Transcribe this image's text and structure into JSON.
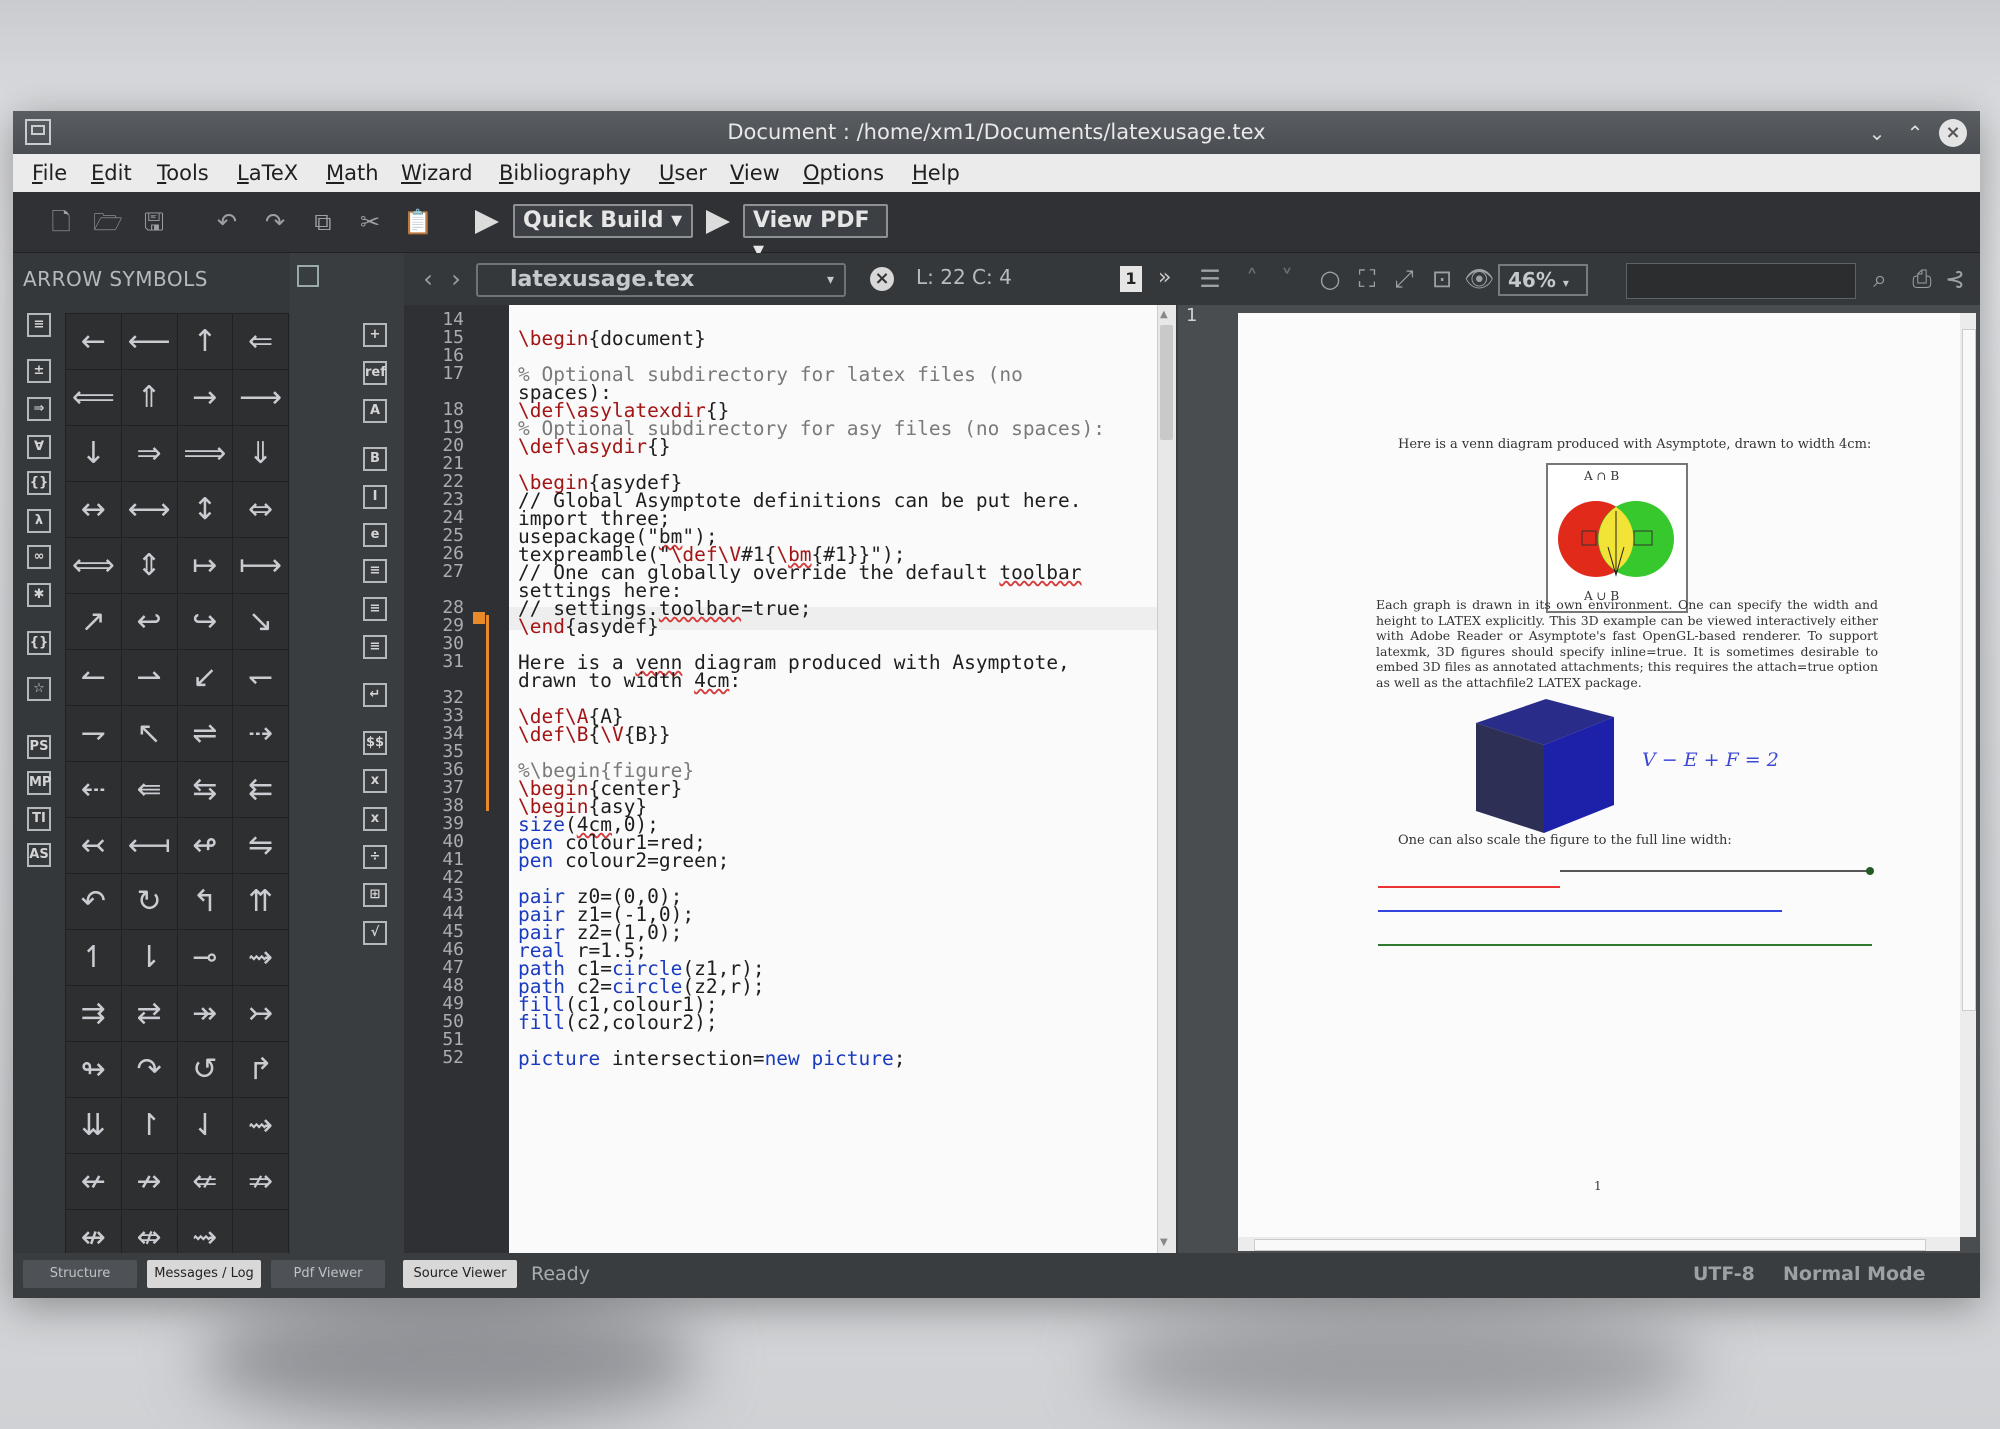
{
  "window": {
    "title": "Document : /home/xm1/Documents/latexusage.tex"
  },
  "menu": [
    "File",
    "Edit",
    "Tools",
    "LaTeX",
    "Math",
    "Wizard",
    "Bibliography",
    "User",
    "View",
    "Options",
    "Help"
  ],
  "toolbar": {
    "quick_build": "Quick Build",
    "view_pdf": "View PDF"
  },
  "left_panel": {
    "title": "ARROW SYMBOLS",
    "symbols": [
      "←",
      "⟵",
      "↑",
      "⇐",
      "⟸",
      "⇑",
      "→",
      "⟶",
      "↓",
      "⇒",
      "⟹",
      "⇓",
      "↔",
      "⟷",
      "↕",
      "⇔",
      "⟺",
      "⇕",
      "↦",
      "⟼",
      "↗",
      "↩",
      "↪",
      "↘",
      "↼",
      "⇀",
      "↙",
      "↽",
      "⇁",
      "↖",
      "⇌",
      "⇢",
      "⇠",
      "⇚",
      "⇆",
      "⇇",
      "↢",
      "⟻",
      "↫",
      "⇋",
      "↶",
      "↻",
      "↰",
      "⇈",
      "↿",
      "⇂",
      "⊸",
      "⇝",
      "⇉",
      "⇄",
      "↠",
      "↣",
      "↬",
      "↷",
      "↺",
      "↱",
      "⇊",
      "↾",
      "⇃",
      "⇝",
      "↚",
      "↛",
      "⇍",
      "⇏",
      "↮",
      "⇎",
      "⇝",
      ""
    ]
  },
  "editor": {
    "filename": "latexusage.tex",
    "cursor": "L: 22 C: 4",
    "lines": [
      {
        "n": "14",
        "t": ""
      },
      {
        "n": "15",
        "t": "\\begin{document}"
      },
      {
        "n": "16",
        "t": ""
      },
      {
        "n": "17",
        "t": "% Optional subdirectory for latex files (no"
      },
      {
        "n": "",
        "t": "spaces):"
      },
      {
        "n": "18",
        "t": "\\def\\asylatexdir{}"
      },
      {
        "n": "19",
        "t": "% Optional subdirectory for asy files (no spaces):"
      },
      {
        "n": "20",
        "t": "\\def\\asydir{}"
      },
      {
        "n": "21",
        "t": ""
      },
      {
        "n": "22",
        "t": "\\begin{asydef}"
      },
      {
        "n": "23",
        "t": "// Global Asymptote definitions can be put here."
      },
      {
        "n": "24",
        "t": "import three;"
      },
      {
        "n": "25",
        "t": "usepackage(\"bm\");"
      },
      {
        "n": "26",
        "t": "texpreamble(\"\\def\\V#1{\\bm{#1}}\");"
      },
      {
        "n": "27",
        "t": "// One can globally override the default toolbar"
      },
      {
        "n": "",
        "t": "settings here:"
      },
      {
        "n": "28",
        "t": "// settings.toolbar=true;"
      },
      {
        "n": "29",
        "t": "\\end{asydef}"
      },
      {
        "n": "30",
        "t": ""
      },
      {
        "n": "31",
        "t": "Here is a venn diagram produced with Asymptote,"
      },
      {
        "n": "",
        "t": "drawn to width 4cm:"
      },
      {
        "n": "32",
        "t": ""
      },
      {
        "n": "33",
        "t": "\\def\\A{A}"
      },
      {
        "n": "34",
        "t": "\\def\\B{\\V{B}}"
      },
      {
        "n": "35",
        "t": ""
      },
      {
        "n": "36",
        "t": "%\\begin{figure}"
      },
      {
        "n": "37",
        "t": "\\begin{center}"
      },
      {
        "n": "38",
        "t": "\\begin{asy}"
      },
      {
        "n": "39",
        "t": "size(4cm,0);"
      },
      {
        "n": "40",
        "t": "pen colour1=red;"
      },
      {
        "n": "41",
        "t": "pen colour2=green;"
      },
      {
        "n": "42",
        "t": ""
      },
      {
        "n": "43",
        "t": "pair z0=(0,0);"
      },
      {
        "n": "44",
        "t": "pair z1=(-1,0);"
      },
      {
        "n": "45",
        "t": "pair z2=(1,0);"
      },
      {
        "n": "46",
        "t": "real r=1.5;"
      },
      {
        "n": "47",
        "t": "path c1=circle(z1,r);"
      },
      {
        "n": "48",
        "t": "path c2=circle(z2,r);"
      },
      {
        "n": "49",
        "t": "fill(c1,colour1);"
      },
      {
        "n": "50",
        "t": "fill(c2,colour2);"
      },
      {
        "n": "51",
        "t": ""
      },
      {
        "n": "52",
        "t": "picture intersection=new picture;"
      }
    ]
  },
  "pdf": {
    "page_num": "1",
    "zoom": "46%",
    "venn_caption": "Here is a venn diagram produced with Asymptote, drawn to width 4cm:",
    "venn_top": "A ∩ B",
    "venn_bottom": "A ∪ B",
    "para": "Each graph is drawn in its own environment. One can specify the width and height to LATEX explicitly. This 3D example can be viewed interactively either with Adobe Reader or Asymptote's fast OpenGL-based renderer. To support latexmk, 3D figures should specify inline=true. It is sometimes desirable to embed 3D files as annotated attachments; this requires the attach=true option as well as the attachfile2 LATEX package.",
    "euler": "V − E + F = 2",
    "scale_caption": "One can also scale the figure to the full line width:",
    "page_footer": "1"
  },
  "status": {
    "tabs": [
      "Structure",
      "Messages / Log",
      "Pdf Viewer",
      "Source Viewer"
    ],
    "ready": "Ready",
    "encoding": "UTF-8",
    "mode": "Normal Mode"
  }
}
